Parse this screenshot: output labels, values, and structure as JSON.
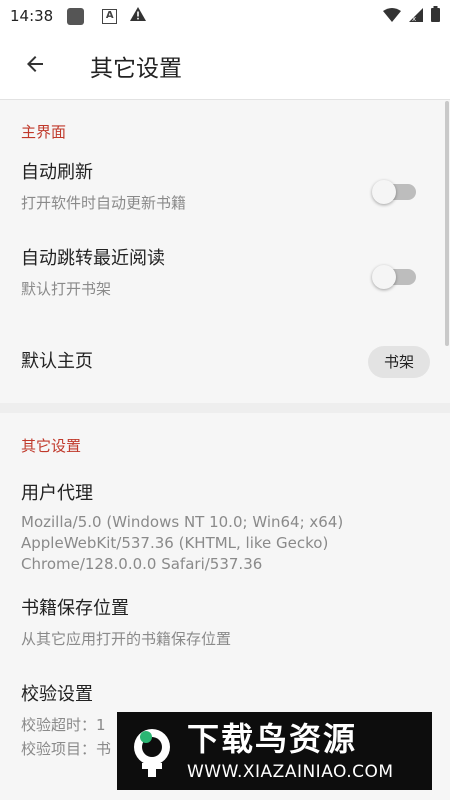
{
  "status_bar": {
    "time": "14:38",
    "icons": [
      "notification-square-icon",
      "a-badge-icon",
      "warning-icon",
      "wifi-icon",
      "signal-icon",
      "battery-icon"
    ]
  },
  "toolbar": {
    "back_icon": "arrow-left-icon",
    "title": "其它设置"
  },
  "sections": {
    "main": {
      "title": "主界面",
      "auto_refresh": {
        "title": "自动刷新",
        "summary": "打开软件时自动更新书籍",
        "enabled": false
      },
      "auto_jump": {
        "title": "自动跳转最近阅读",
        "summary": "默认打开书架",
        "enabled": false
      },
      "default_home": {
        "title": "默认主页",
        "value": "书架"
      }
    },
    "other": {
      "title": "其它设置",
      "user_agent": {
        "title": "用户代理",
        "summary": "Mozilla/5.0 (Windows NT 10.0; Win64; x64) AppleWebKit/537.36 (KHTML, like Gecko) Chrome/128.0.0.0 Safari/537.36"
      },
      "book_location": {
        "title": "书籍保存位置",
        "summary": "从其它应用打开的书籍保存位置"
      },
      "verify": {
        "title": "校验设置",
        "timeout": "校验超时：1",
        "items": "校验项目：书"
      }
    }
  },
  "watermark": {
    "main": "下载鸟资源",
    "url": "WWW.XIAZAINIAO.COM"
  },
  "colors": {
    "accent": "#c0392b",
    "background": "#f6f6f6",
    "toolbar": "#ffffff",
    "switch_track": "#bdbdbd",
    "chip": "#e3e3e3"
  }
}
